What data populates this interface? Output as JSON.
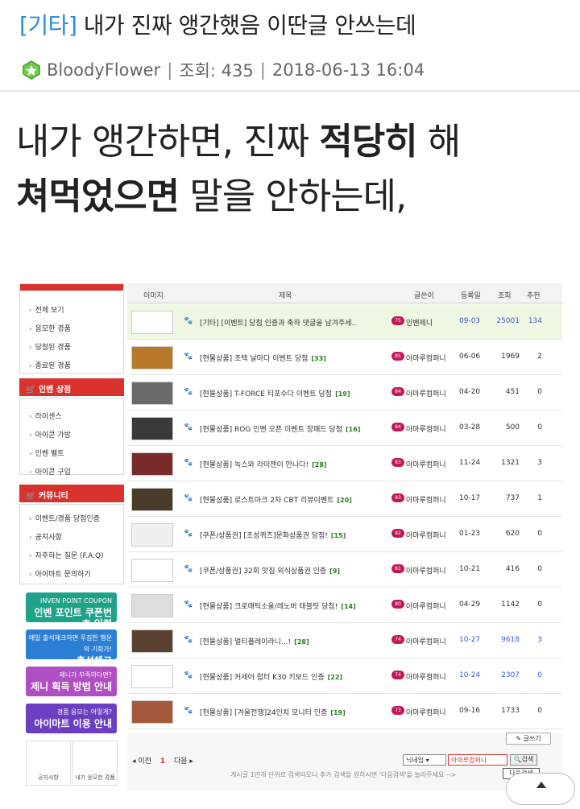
{
  "post": {
    "category": "[기타]",
    "title": "내가 진짜 앵간했음 이딴글 안쓰는데",
    "author": "BloodyFlower",
    "views_label": "조회: 435",
    "date": "2018-06-13 16:04",
    "body_line1_a": "내가 앵간하면, 진짜 ",
    "body_line1_b": "적당히",
    "body_line1_c": " 해",
    "body_line2_a": "쳐먹었으면",
    "body_line2_b": " 말을 안하는데,"
  },
  "screenshot": {
    "sidebar": {
      "group1_items": [
        "전체 보기",
        "응모한 경품",
        "당첨된 경품",
        "종료된 경품"
      ],
      "shop_title": "인벤 상점",
      "shop_items": [
        "라이센스",
        "아이콘 가방",
        "인벤 벨트",
        "아이콘 구입"
      ],
      "community_title": "커뮤니티",
      "community_items": [
        "이벤트/경품 당첨인증",
        "공지사항",
        "자주하는 질문 (F.A.Q)",
        "아이마트 문의하기"
      ],
      "banners": [
        {
          "small": "INVEN POINT COUPON",
          "main": "인벤 포인트 쿠폰번호 입력",
          "color": "#1fa28a"
        },
        {
          "small": "매일 출석체크하면 푸짐한 행운의 기회가!",
          "main": "출석체크",
          "color": "#2b7fd6"
        },
        {
          "small": "제니가 부족하다면?",
          "main": "제니 획득 방법 안내",
          "color": "#b04fc4"
        },
        {
          "small": "경품 응모는 어떻게?",
          "main": "아이마트 이용 안내",
          "color": "#6a3fc2"
        }
      ],
      "bottom_buttons": [
        "공지사항",
        "내가 응모한 경품"
      ]
    },
    "table": {
      "headers": [
        "이미지",
        "제목",
        "글쓴이",
        "등록일",
        "조회",
        "추천"
      ],
      "rows": [
        {
          "subject": "[기타] [이벤트] 당첨 인증과 축하 댓글을 남겨주세..",
          "count": "",
          "level": "75",
          "author": "인벤제니",
          "date": "09-03",
          "views": "25001",
          "rec": "134",
          "highlight": true,
          "blue": true
        },
        {
          "subject": "[현물상품] 조텍 날마다 이벤트 당첨",
          "count": "[33]",
          "level": "85",
          "author": "아마루컴퍼니",
          "date": "06-06",
          "views": "1969",
          "rec": "2"
        },
        {
          "subject": "[현물상품] T-FORCE 티포수다 이벤트 당첨",
          "count": "[19]",
          "level": "84",
          "author": "아마루컴퍼니",
          "date": "04-20",
          "views": "451",
          "rec": "0"
        },
        {
          "subject": "[현물상품] ROG 인벤 오픈 이벤트 장패드 당첨",
          "count": "[16]",
          "level": "84",
          "author": "아마루컴퍼니",
          "date": "03-28",
          "views": "500",
          "rec": "0"
        },
        {
          "subject": "[현물상품] 녹스와 라이젠이 만나다!",
          "count": "[28]",
          "level": "83",
          "author": "아마루컴퍼니",
          "date": "11-24",
          "views": "1321",
          "rec": "3"
        },
        {
          "subject": "[현물상품] 로스트아크 2차 CBT 리뷰이벤트",
          "count": "[20]",
          "level": "83",
          "author": "아마루컴퍼니",
          "date": "10-17",
          "views": "737",
          "rec": "1"
        },
        {
          "subject": "[쿠폰/상품권] [초성퀴즈]문화상품권 당첨!",
          "count": "[15]",
          "level": "82",
          "author": "아마루컴퍼니",
          "date": "01-23",
          "views": "620",
          "rec": "0"
        },
        {
          "subject": "[쿠폰/상품권] 32회 맛집 외식상품권 인증",
          "count": "[9]",
          "level": "81",
          "author": "아마루컴퍼니",
          "date": "10-21",
          "views": "416",
          "rec": "0"
        },
        {
          "subject": "[현물상품] 크로매틱소울/레노버 태블릿 당첨!",
          "count": "[14]",
          "level": "80",
          "author": "아마루컴퍼니",
          "date": "04-29",
          "views": "1142",
          "rec": "0"
        },
        {
          "subject": "[현물상품] 멀티플레이라니...!",
          "count": "[28]",
          "level": "74",
          "author": "아마루컴퍼니",
          "date": "10-27",
          "views": "9618",
          "rec": "3",
          "blue": true
        },
        {
          "subject": "[현물상품] 커세어 럽터 K30 키보드 인증",
          "count": "[22]",
          "level": "74",
          "author": "아마루컴퍼니",
          "date": "10-24",
          "views": "2307",
          "rec": "0",
          "blue": true
        },
        {
          "subject": "[현물상품] [겨울전쟁]24인치 모니터 인증",
          "count": "[19]",
          "level": "73",
          "author": "아마루컴퍼니",
          "date": "09-16",
          "views": "1733",
          "rec": "0"
        }
      ]
    },
    "footer": {
      "write": "글쓰기",
      "prev": "이전",
      "page": "1",
      "next": "다음",
      "select": "닉네임",
      "search_value": "아마루컴퍼니",
      "search_btn": "검색",
      "note": "게시글 1만개 단위로 검색되오니 추가 검색을 원하시면 '다음검색'을 눌러주세요 -->",
      "next_search": "다음검색"
    }
  },
  "colors": {
    "category": "#2a8bd6",
    "sidebar_head": "#d9322d",
    "highlight_row": "#eef7e2"
  }
}
